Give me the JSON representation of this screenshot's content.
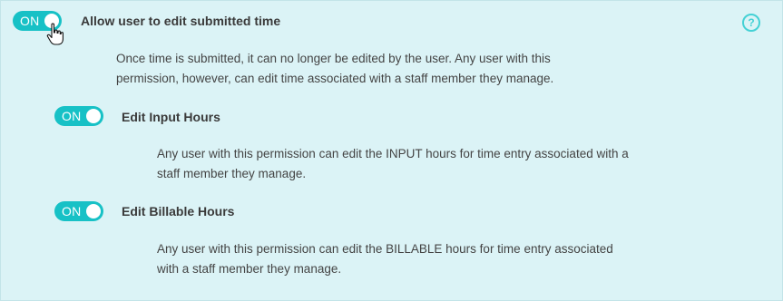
{
  "main_setting": {
    "toggle_label": "ON",
    "title": "Allow user to edit submitted time",
    "description_line1": "Once time is submitted, it can no longer be edited by the user. Any user with this",
    "description_line2": "permission, however, can edit time associated with a staff member they manage.",
    "help_icon": "?"
  },
  "sub_settings": [
    {
      "toggle_label": "ON",
      "title": "Edit Input Hours",
      "description_line1": "Any user with this permission can edit the INPUT hours for time entry associated with a",
      "description_line2": "staff member they manage."
    },
    {
      "toggle_label": "ON",
      "title": "Edit Billable Hours",
      "description_line1": "Any user with this permission can edit the BILLABLE hours for time entry associated",
      "description_line2": "with a staff member they manage."
    }
  ],
  "colors": {
    "background": "#dbf3f6",
    "toggle_on": "#17c1c6",
    "help_icon": "#45d1d5"
  }
}
